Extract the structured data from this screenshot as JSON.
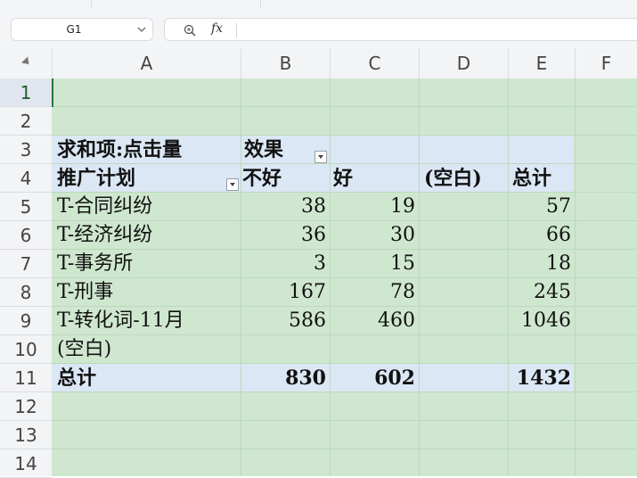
{
  "name_box": {
    "value": "G1"
  },
  "formula_bar": {
    "fx_label": "fx",
    "value": ""
  },
  "columns": [
    "A",
    "B",
    "C",
    "D",
    "E",
    "F"
  ],
  "rows": [
    "1",
    "2",
    "3",
    "4",
    "5",
    "6",
    "7",
    "8",
    "9",
    "10",
    "11",
    "12",
    "13",
    "14"
  ],
  "selected_row": "1",
  "pivot": {
    "sum_label": "求和项:点击量",
    "col_field": "效果",
    "row_field": "推广计划",
    "col_headers": [
      "不好",
      "好",
      "(空白)",
      "总计"
    ],
    "rows": [
      {
        "label": "T-合同纠纷",
        "bad": "38",
        "good": "19",
        "blank": "",
        "total": "57"
      },
      {
        "label": "T-经济纠纷",
        "bad": "36",
        "good": "30",
        "blank": "",
        "total": "66"
      },
      {
        "label": "T-事务所",
        "bad": "3",
        "good": "15",
        "blank": "",
        "total": "18"
      },
      {
        "label": "T-刑事",
        "bad": "167",
        "good": "78",
        "blank": "",
        "total": "245"
      },
      {
        "label": "T-转化词-11月",
        "bad": "586",
        "good": "460",
        "blank": "",
        "total": "1046"
      },
      {
        "label": "(空白)",
        "bad": "",
        "good": "",
        "blank": "",
        "total": ""
      }
    ],
    "grand_total": {
      "label": "总计",
      "bad": "830",
      "good": "602",
      "blank": "",
      "total": "1432"
    }
  },
  "colors": {
    "grid_fill": "#cfe7cf",
    "pivot_band": "#dbe7f4",
    "cursor": "#1f7a3a"
  }
}
